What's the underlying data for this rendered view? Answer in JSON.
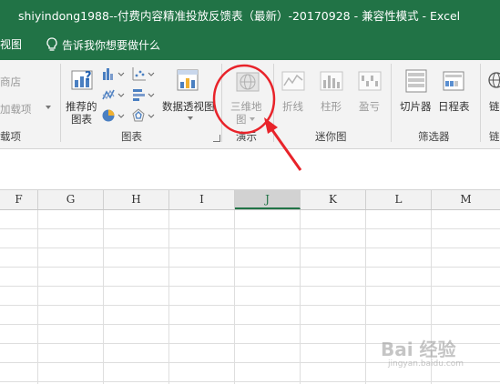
{
  "window": {
    "title": "shiyindong1988--付费内容精准投放反馈表（最新）-20170928  -  兼容性模式  -  Excel"
  },
  "tellbar": {
    "view_tab": "视图",
    "tell_me": "告诉我你想要做什么"
  },
  "ribbon": {
    "store_partial": "商店",
    "addins_partial": "加载项",
    "addins_group_partial": "载项",
    "recommended_charts": [
      "推荐的",
      "图表"
    ],
    "charts_group": "图表",
    "pivot_chart": "数据透视图",
    "map3d": [
      "三维地",
      "图"
    ],
    "tours_group": "演示",
    "sparkline_line": "折线",
    "sparkline_column": "柱形",
    "sparkline_winloss": "盈亏",
    "sparklines_group": "迷你图",
    "slicer": "切片器",
    "timeline": "日程表",
    "filters_group": "筛选器",
    "link_partial": "链",
    "links_group_partial": "链"
  },
  "columns": [
    "F",
    "G",
    "H",
    "I",
    "J",
    "K",
    "L",
    "M"
  ],
  "selected_column": "J",
  "watermark": {
    "main": "Bai 经验",
    "sub": "jingyan.baidu.com"
  },
  "colors": {
    "excel_green": "#217346",
    "annotation_red": "#e8232a"
  }
}
